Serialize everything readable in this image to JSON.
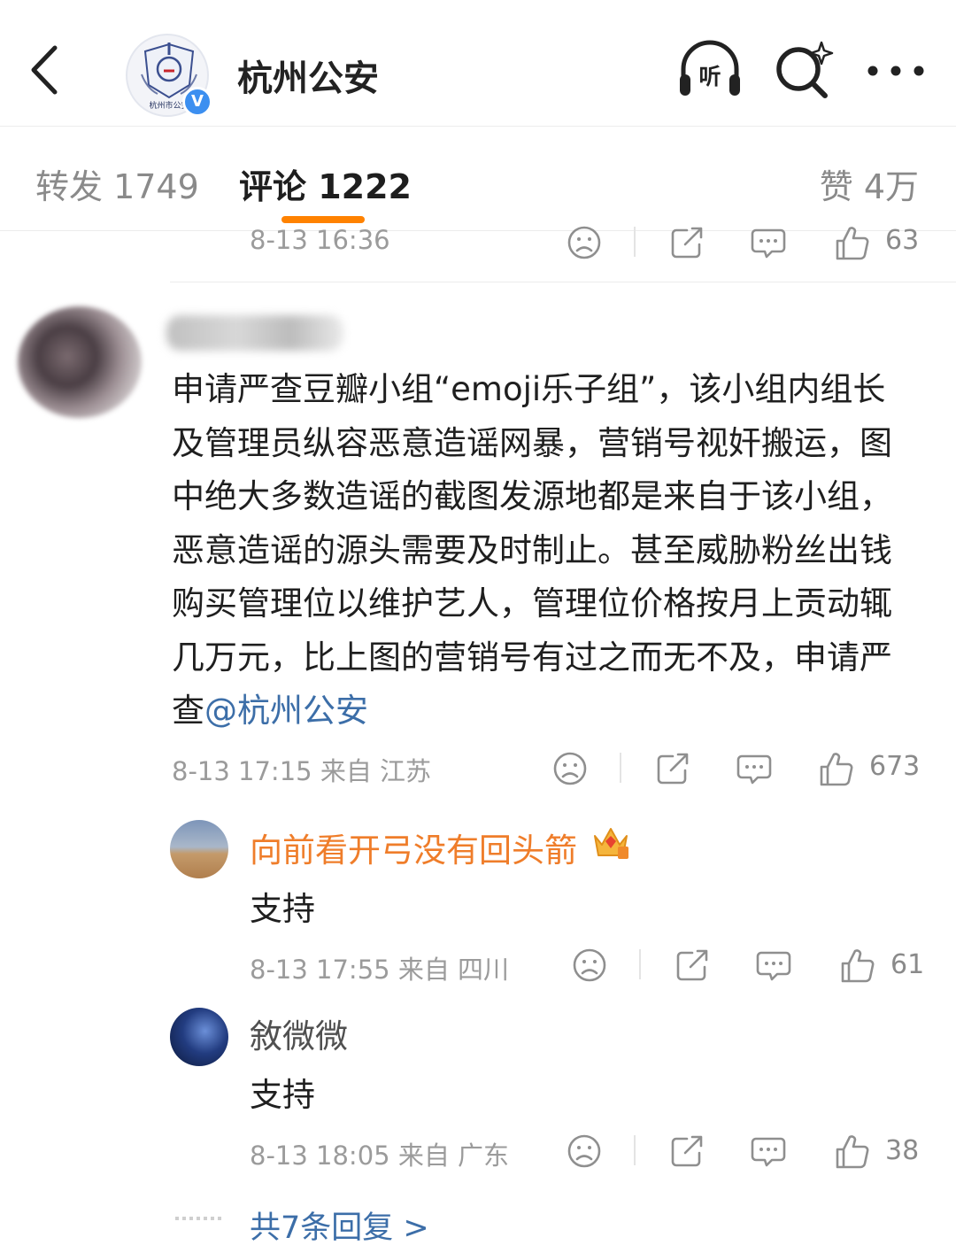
{
  "header": {
    "account_name": "杭州公安",
    "avatar_lettering": "杭州市公安",
    "verified_mark": "V",
    "listen_label": "听",
    "icons": [
      "back-chevron-icon",
      "listen-headphones-icon",
      "search-sparkle-icon",
      "more-dots-icon"
    ]
  },
  "tabs": {
    "repost": "转发 1749",
    "comment": "评论 1222",
    "like": "赞 4万",
    "active": "comment",
    "accent_color": "#ff8200"
  },
  "prev_comment": {
    "time": "8-13 16:36",
    "likes": "63"
  },
  "main_comment": {
    "text": "申请严查豆瓣小组“emoji乐子组”，该小组内组长及管理员纵容恶意造谣网暴，营销号视奸搬运，图中绝大多数造谣的截图发源地都是来自于该小组，恶意造谣的源头需要及时制止。甚至威胁粉丝出钱购买管理位以维护艺人，管理位价格按月上贡动辄几万元，比上图的营销号有过之而无不及，申请严查",
    "mention": "@杭州公安",
    "meta": "8-13 17:15 来自 江苏",
    "likes": "673"
  },
  "replies": [
    {
      "name": "向前看开弓没有回头箭",
      "text": "支持",
      "meta": "8-13 17:55 来自 四川",
      "likes": "61",
      "name_color": "#ef7d2a"
    },
    {
      "name": "敘微微",
      "text": "支持",
      "meta": "8-13 18:05 来自 广东",
      "likes": "38"
    }
  ],
  "more_replies": "共7条回复 >"
}
